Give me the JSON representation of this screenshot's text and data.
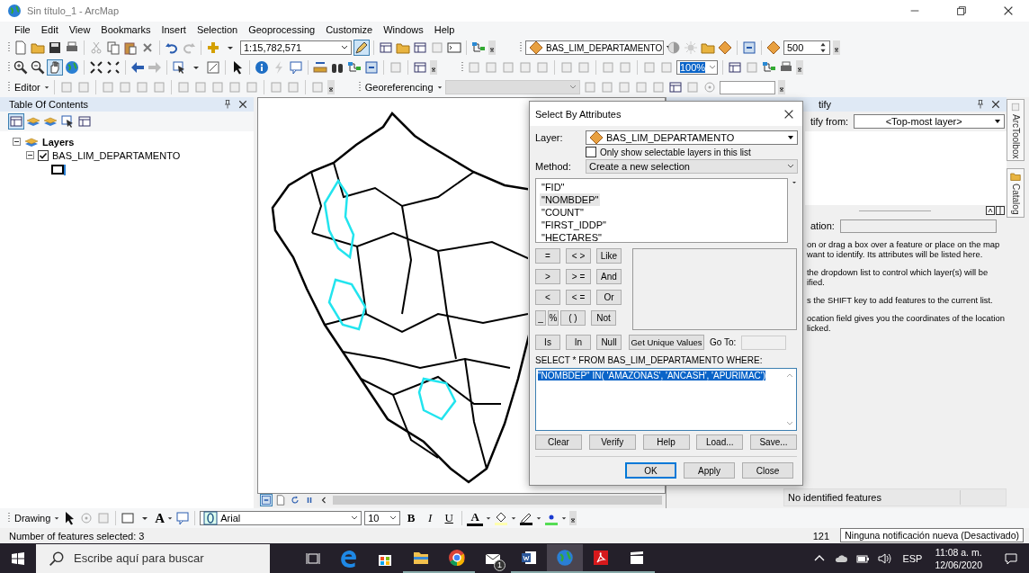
{
  "window": {
    "title": "Sin título_1 - ArcMap"
  },
  "menu": [
    "File",
    "Edit",
    "View",
    "Bookmarks",
    "Insert",
    "Selection",
    "Geoprocessing",
    "Customize",
    "Windows",
    "Help"
  ],
  "toolbar": {
    "scale": "1:15,782,571",
    "layer": "BAS_LIM_DEPARTAMENTO",
    "lookup": "500",
    "zoom": "100%",
    "editor": "Editor",
    "georeferencing": "Georeferencing",
    "pan_selected": true
  },
  "toc": {
    "title": "Table Of Contents",
    "tree": [
      {
        "label": "Layers",
        "expanded": true,
        "children": [
          {
            "label": "BAS_LIM_DEPARTAMENTO",
            "checked": true,
            "expanded": true
          }
        ]
      }
    ]
  },
  "dialog": {
    "title": "Select By Attributes",
    "layer_label": "Layer:",
    "layer": "BAS_LIM_DEPARTAMENTO",
    "selectable_only": {
      "label": "Only show selectable layers in this list",
      "checked": false
    },
    "method_label": "Method:",
    "method": "Create a new selection",
    "fields": [
      {
        "label": "\"FID\"",
        "selected": false
      },
      {
        "label": "\"NOMBDEP\"",
        "selected": true
      },
      {
        "label": "\"COUNT\"",
        "selected": false
      },
      {
        "label": "\"FIRST_IDDP\"",
        "selected": false
      },
      {
        "label": "\"HECTARES\"",
        "selected": false
      }
    ],
    "operators": [
      [
        "=",
        "< >",
        "Like"
      ],
      [
        ">",
        "> =",
        "And"
      ],
      [
        "<",
        "< =",
        "Or"
      ],
      [
        "_",
        "%",
        "( )",
        "Not"
      ]
    ],
    "operators_bottom": [
      "Is",
      "In",
      "Null"
    ],
    "unique_button": "Get Unique Values",
    "goto_label": "Go To:",
    "sql_label": "SELECT * FROM BAS_LIM_DEPARTAMENTO WHERE:",
    "expression": "\"NOMBDEP\" IN( 'AMAZONAS', 'ANCASH', 'APURIMAC')",
    "expression_selected": true,
    "buttons": [
      "Clear",
      "Verify",
      "Help",
      "Load...",
      "Save..."
    ],
    "footer_buttons": [
      "OK",
      "Apply",
      "Close"
    ]
  },
  "identify": {
    "title": "tify",
    "from_label": "tify from:",
    "from": "<Top-most layer>",
    "location_label": "ation:",
    "help": [
      "on or drag a box over a feature or place on the map\nwant to identify. Its attributes will be listed here.",
      "the dropdown list to control which layer(s) will be\nified.",
      "s the SHIFT key to add features to the current list.",
      "ocation field gives you the coordinates of the location\nlicked."
    ],
    "result": "No identified features"
  },
  "dock_tabs": [
    "ArcToolbox",
    "Catalog"
  ],
  "drawing": {
    "menu": "Drawing",
    "text_tool": "A",
    "font": "Arial",
    "size": "10",
    "bold": "B",
    "italic": "I",
    "underline": "U",
    "font_color": "A"
  },
  "status": {
    "text": "Number of features selected: 3",
    "count": "121"
  },
  "tooltip": "Ninguna notificación nueva (Desactivado)",
  "taskbar": {
    "search_placeholder": "Escribe aquí para buscar",
    "mail_badge": "1",
    "language": "ESP",
    "time": "11:08 a. m.",
    "date": "12/06/2020"
  }
}
